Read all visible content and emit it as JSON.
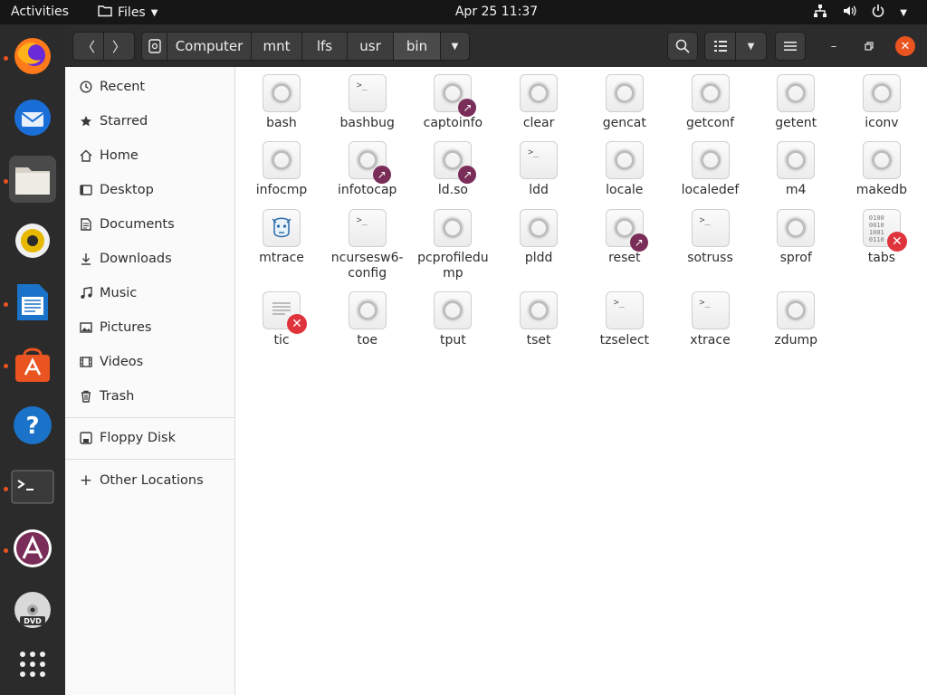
{
  "topbar": {
    "activities": "Activities",
    "app_menu": "Files",
    "clock": "Apr 25  11:37"
  },
  "dock": {
    "items": [
      {
        "name": "firefox",
        "running": true
      },
      {
        "name": "thunderbird",
        "running": false
      },
      {
        "name": "files",
        "running": true,
        "active": true
      },
      {
        "name": "rhythmbox",
        "running": false
      },
      {
        "name": "libreoffice-writer",
        "running": true
      },
      {
        "name": "software",
        "running": true
      },
      {
        "name": "help",
        "running": false
      },
      {
        "name": "terminal",
        "running": true
      },
      {
        "name": "software-updater",
        "running": true
      },
      {
        "name": "dvd",
        "running": false
      },
      {
        "name": "show-applications",
        "running": false
      }
    ]
  },
  "breadcrumb": [
    "Computer",
    "mnt",
    "lfs",
    "usr",
    "bin"
  ],
  "sidebar": {
    "places": [
      {
        "label": "Recent",
        "icon": "clock-icon"
      },
      {
        "label": "Starred",
        "icon": "star-icon"
      },
      {
        "label": "Home",
        "icon": "home-icon"
      },
      {
        "label": "Desktop",
        "icon": "desktop-icon"
      },
      {
        "label": "Documents",
        "icon": "document-icon"
      },
      {
        "label": "Downloads",
        "icon": "download-icon"
      },
      {
        "label": "Music",
        "icon": "music-icon"
      },
      {
        "label": "Pictures",
        "icon": "picture-icon"
      },
      {
        "label": "Videos",
        "icon": "video-icon"
      },
      {
        "label": "Trash",
        "icon": "trash-icon"
      }
    ],
    "devices": [
      {
        "label": "Floppy Disk",
        "icon": "floppy-icon"
      }
    ],
    "other": [
      {
        "label": "Other Locations",
        "icon": "plus-icon"
      }
    ]
  },
  "files": [
    {
      "name": "bash",
      "type": "exec"
    },
    {
      "name": "bashbug",
      "type": "script"
    },
    {
      "name": "captoinfo",
      "type": "exec",
      "badge": "link"
    },
    {
      "name": "clear",
      "type": "exec"
    },
    {
      "name": "gencat",
      "type": "exec"
    },
    {
      "name": "getconf",
      "type": "exec"
    },
    {
      "name": "getent",
      "type": "exec"
    },
    {
      "name": "iconv",
      "type": "exec"
    },
    {
      "name": "infocmp",
      "type": "exec"
    },
    {
      "name": "infotocap",
      "type": "exec",
      "badge": "link"
    },
    {
      "name": "ld.so",
      "type": "exec",
      "badge": "link"
    },
    {
      "name": "ldd",
      "type": "script"
    },
    {
      "name": "locale",
      "type": "exec"
    },
    {
      "name": "localedef",
      "type": "exec"
    },
    {
      "name": "m4",
      "type": "exec"
    },
    {
      "name": "makedb",
      "type": "exec"
    },
    {
      "name": "mtrace",
      "type": "perl"
    },
    {
      "name": "ncursesw6-config",
      "line1": "ncursesw6-",
      "line2": "config",
      "type": "script"
    },
    {
      "name": "pcprofiledump",
      "line1": "pcprofiledu",
      "line2": "mp",
      "type": "exec"
    },
    {
      "name": "pldd",
      "type": "exec"
    },
    {
      "name": "reset",
      "type": "exec",
      "badge": "link"
    },
    {
      "name": "sotruss",
      "type": "script"
    },
    {
      "name": "sprof",
      "type": "exec"
    },
    {
      "name": "tabs",
      "type": "binary",
      "badge": "broken"
    },
    {
      "name": "tic",
      "type": "text",
      "badge": "broken"
    },
    {
      "name": "toe",
      "type": "exec"
    },
    {
      "name": "tput",
      "type": "exec"
    },
    {
      "name": "tset",
      "type": "exec"
    },
    {
      "name": "tzselect",
      "type": "script"
    },
    {
      "name": "xtrace",
      "type": "script"
    },
    {
      "name": "zdump",
      "type": "exec"
    }
  ]
}
